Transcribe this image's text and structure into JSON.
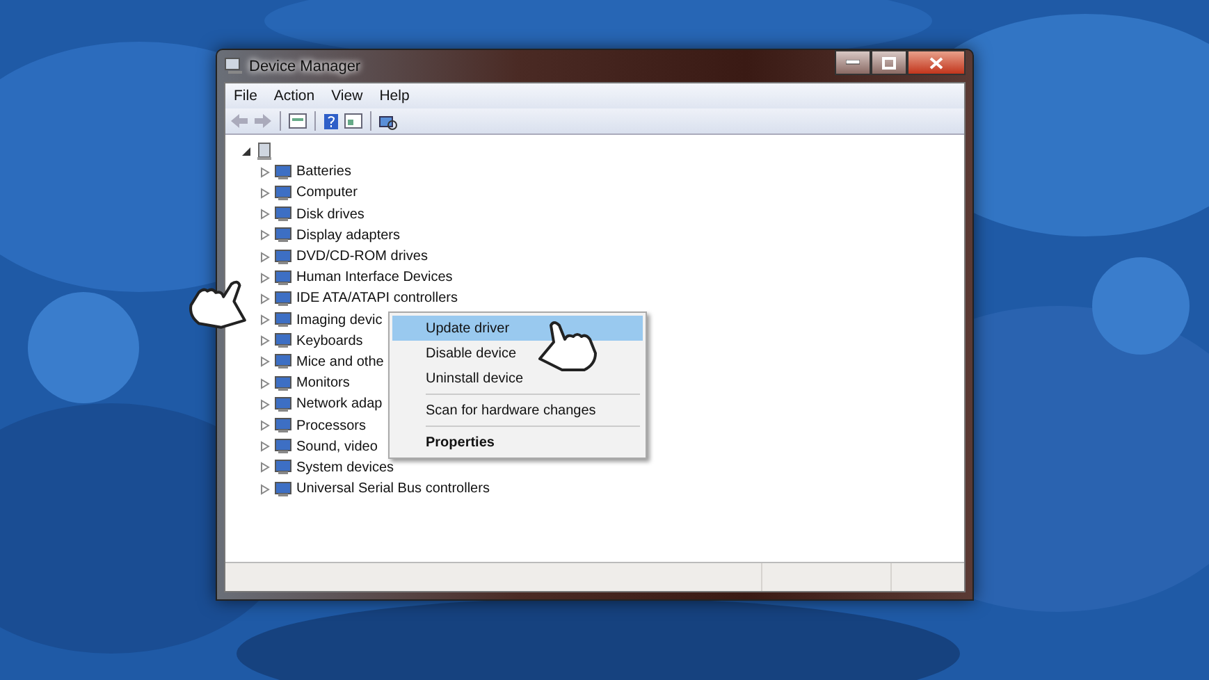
{
  "window": {
    "title": "Device Manager"
  },
  "menu_bar": [
    "File",
    "Action",
    "View",
    "Help"
  ],
  "tree": {
    "expanded": true,
    "children": [
      {
        "label": "Batteries",
        "expanded": false
      },
      {
        "label": "Computer",
        "expanded": false
      },
      {
        "label": "Disk drives",
        "expanded": false
      },
      {
        "label": "Display adapters",
        "expanded": false
      },
      {
        "label": "DVD/CD-ROM drives",
        "expanded": false
      },
      {
        "label": "Human Interface Devices",
        "expanded": false
      },
      {
        "label": "IDE ATA/ATAPI controllers",
        "expanded": false
      },
      {
        "label": "Imaging devic",
        "expanded": false
      },
      {
        "label": "Keyboards",
        "expanded": false
      },
      {
        "label": "Mice and othe",
        "expanded": false
      },
      {
        "label": "Monitors",
        "expanded": false
      },
      {
        "label": "Network adap",
        "expanded": false
      },
      {
        "label": "Processors",
        "expanded": false
      },
      {
        "label": "Sound, video",
        "expanded": false
      },
      {
        "label": "System devices",
        "expanded": false
      },
      {
        "label": "Universal Serial Bus controllers",
        "expanded": false
      }
    ]
  },
  "context_menu": [
    {
      "kind": "item",
      "label": "Update driver",
      "selected": true,
      "default": false
    },
    {
      "kind": "item",
      "label": "Disable device",
      "selected": false,
      "default": false
    },
    {
      "kind": "item",
      "label": "Uninstall device",
      "selected": false,
      "default": false
    },
    {
      "kind": "separator"
    },
    {
      "kind": "item",
      "label": "Scan for hardware changes",
      "selected": false,
      "default": false
    },
    {
      "kind": "separator"
    },
    {
      "kind": "item",
      "label": "Properties",
      "selected": false,
      "default": true
    }
  ]
}
